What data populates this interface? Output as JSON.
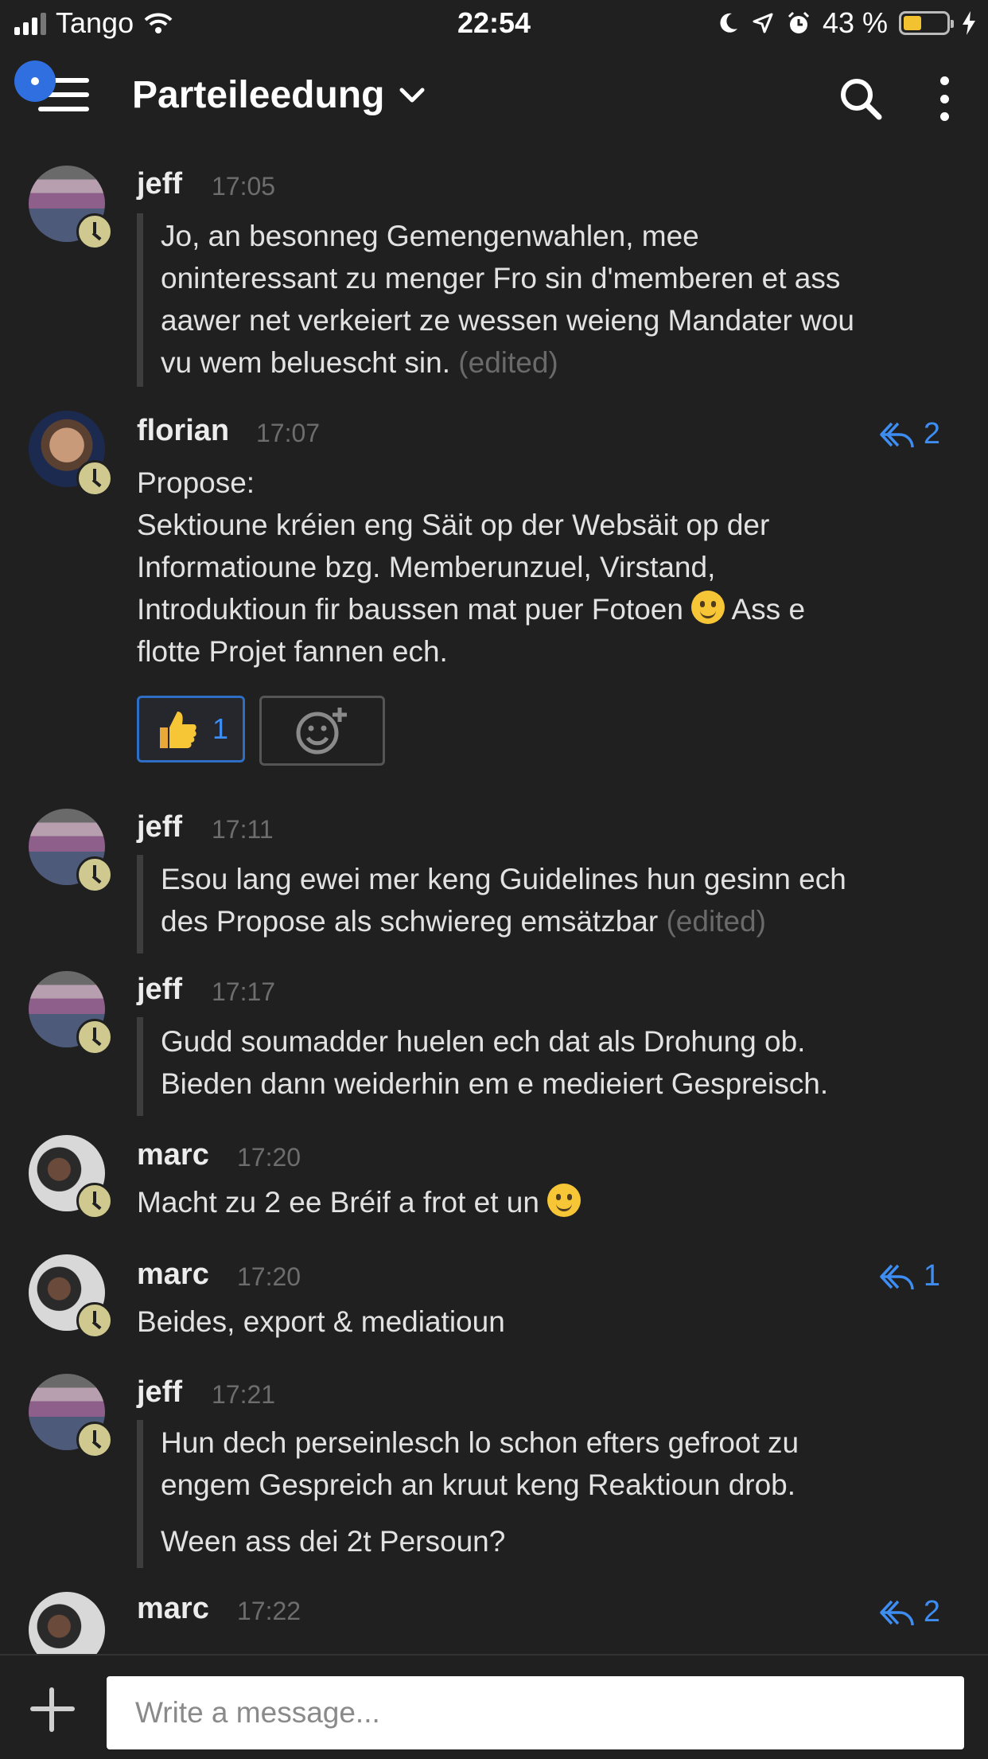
{
  "status_bar": {
    "carrier": "Tango",
    "time": "22:54",
    "battery_percent": "43 %",
    "battery_level": 0.43,
    "battery_color": "#f2c230"
  },
  "header": {
    "channel_name": "Parteileedung",
    "icons": [
      "menu-icon",
      "chevron-down-icon",
      "search-icon",
      "more-vertical-icon"
    ],
    "notification_color": "#2f6fe0"
  },
  "messages": [
    {
      "author": "jeff",
      "time": "17:05",
      "lines": [
        "Jo, an besonneg Gemengenwahlen, mee",
        "oninteressant zu menger Fro sin d'memberen et ass",
        "aawer net verkeiert ze wessen weieng Mandater wou",
        "vu wem beluescht sin."
      ],
      "edited": "(edited)"
    },
    {
      "author": "florian",
      "time": "17:07",
      "reply_count": "2",
      "lines": [
        "Propose:",
        "Sektioune kréien eng Säit op der Websäit op der",
        "Informatioune bzg. Memberunzuel, Virstand,",
        "Introduktioun fir baussen mat puer Fotoen",
        "flotte Projet fannen ech."
      ],
      "line4_after_emoji": "Ass e",
      "reaction_count": "1"
    },
    {
      "author": "jeff",
      "time": "17:11",
      "lines": [
        "Esou lang ewei mer keng Guidelines hun gesinn ech",
        "des Propose als schwiereg emsätzbar"
      ],
      "edited": "(edited)"
    },
    {
      "author": "jeff",
      "time": "17:17",
      "lines": [
        "Gudd soumadder huelen ech dat als Drohung ob.",
        "Bieden dann weiderhin em e medieiert Gespreisch."
      ]
    },
    {
      "author": "marc",
      "time": "17:20",
      "lines": [
        "Macht zu 2 ee Bréif a frot et un"
      ]
    },
    {
      "author": "marc",
      "time": "17:20",
      "reply_count": "1",
      "lines": [
        "Beides, export & mediatioun"
      ]
    },
    {
      "author": "jeff",
      "time": "17:21",
      "lines": [
        "Hun dech perseinlesch lo schon efters gefroot zu",
        "engem Gespreich an kruut keng Reaktioun drob.",
        "Ween ass dei 2t Persoun?"
      ]
    },
    {
      "author": "marc",
      "time": "17:22",
      "reply_count": "2",
      "lines": []
    }
  ],
  "composer": {
    "placeholder": "Write a message..."
  },
  "colors": {
    "background": "#202020",
    "accent": "#3d8df2",
    "away_status": "#cfc98f"
  }
}
